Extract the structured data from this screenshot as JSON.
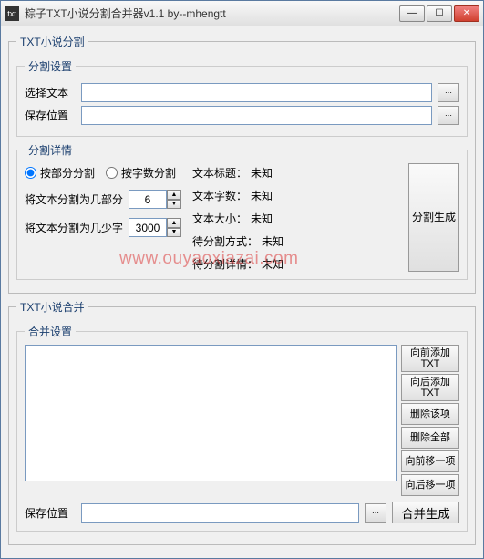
{
  "titlebar": {
    "icon_text": "txt",
    "title": "粽子TXT小说分割合并器v1.1      by--mhengtt"
  },
  "split": {
    "group_label": "TXT小说分割",
    "settings": {
      "legend": "分割设置",
      "select_text_label": "选择文本",
      "select_text_value": "",
      "save_path_label": "保存位置",
      "save_path_value": "",
      "browse_glyph": "⋯"
    },
    "details": {
      "legend": "分割详情",
      "radio_part": "按部分分割",
      "radio_chars": "按字数分割",
      "parts_label": "将文本分割为几部分",
      "parts_value": "6",
      "chars_label": "将文本分割为几少字",
      "chars_value": "3000",
      "info_title_label": "文本标题：",
      "info_title_value": "未知",
      "info_count_label": "文本字数：",
      "info_count_value": "未知",
      "info_size_label": "文本大小：",
      "info_size_value": "未知",
      "info_mode_label": "待分割方式：",
      "info_mode_value": "未知",
      "info_detail_label": "待分割详情：",
      "info_detail_value": "未知",
      "generate_btn": "分割生成"
    }
  },
  "merge": {
    "group_label": "TXT小说合并",
    "settings_legend": "合并设置",
    "btns": {
      "add_front": "向前添加TXT",
      "add_back": "向后添加TXT",
      "del_item": "删除该项",
      "del_all": "删除全部",
      "move_up": "向前移一项",
      "move_down": "向后移一项"
    },
    "save_label": "保存位置",
    "save_value": "",
    "browse_glyph": "⋯",
    "generate_btn": "合并生成"
  },
  "watermark": "www.ouyaoxiazai.com"
}
